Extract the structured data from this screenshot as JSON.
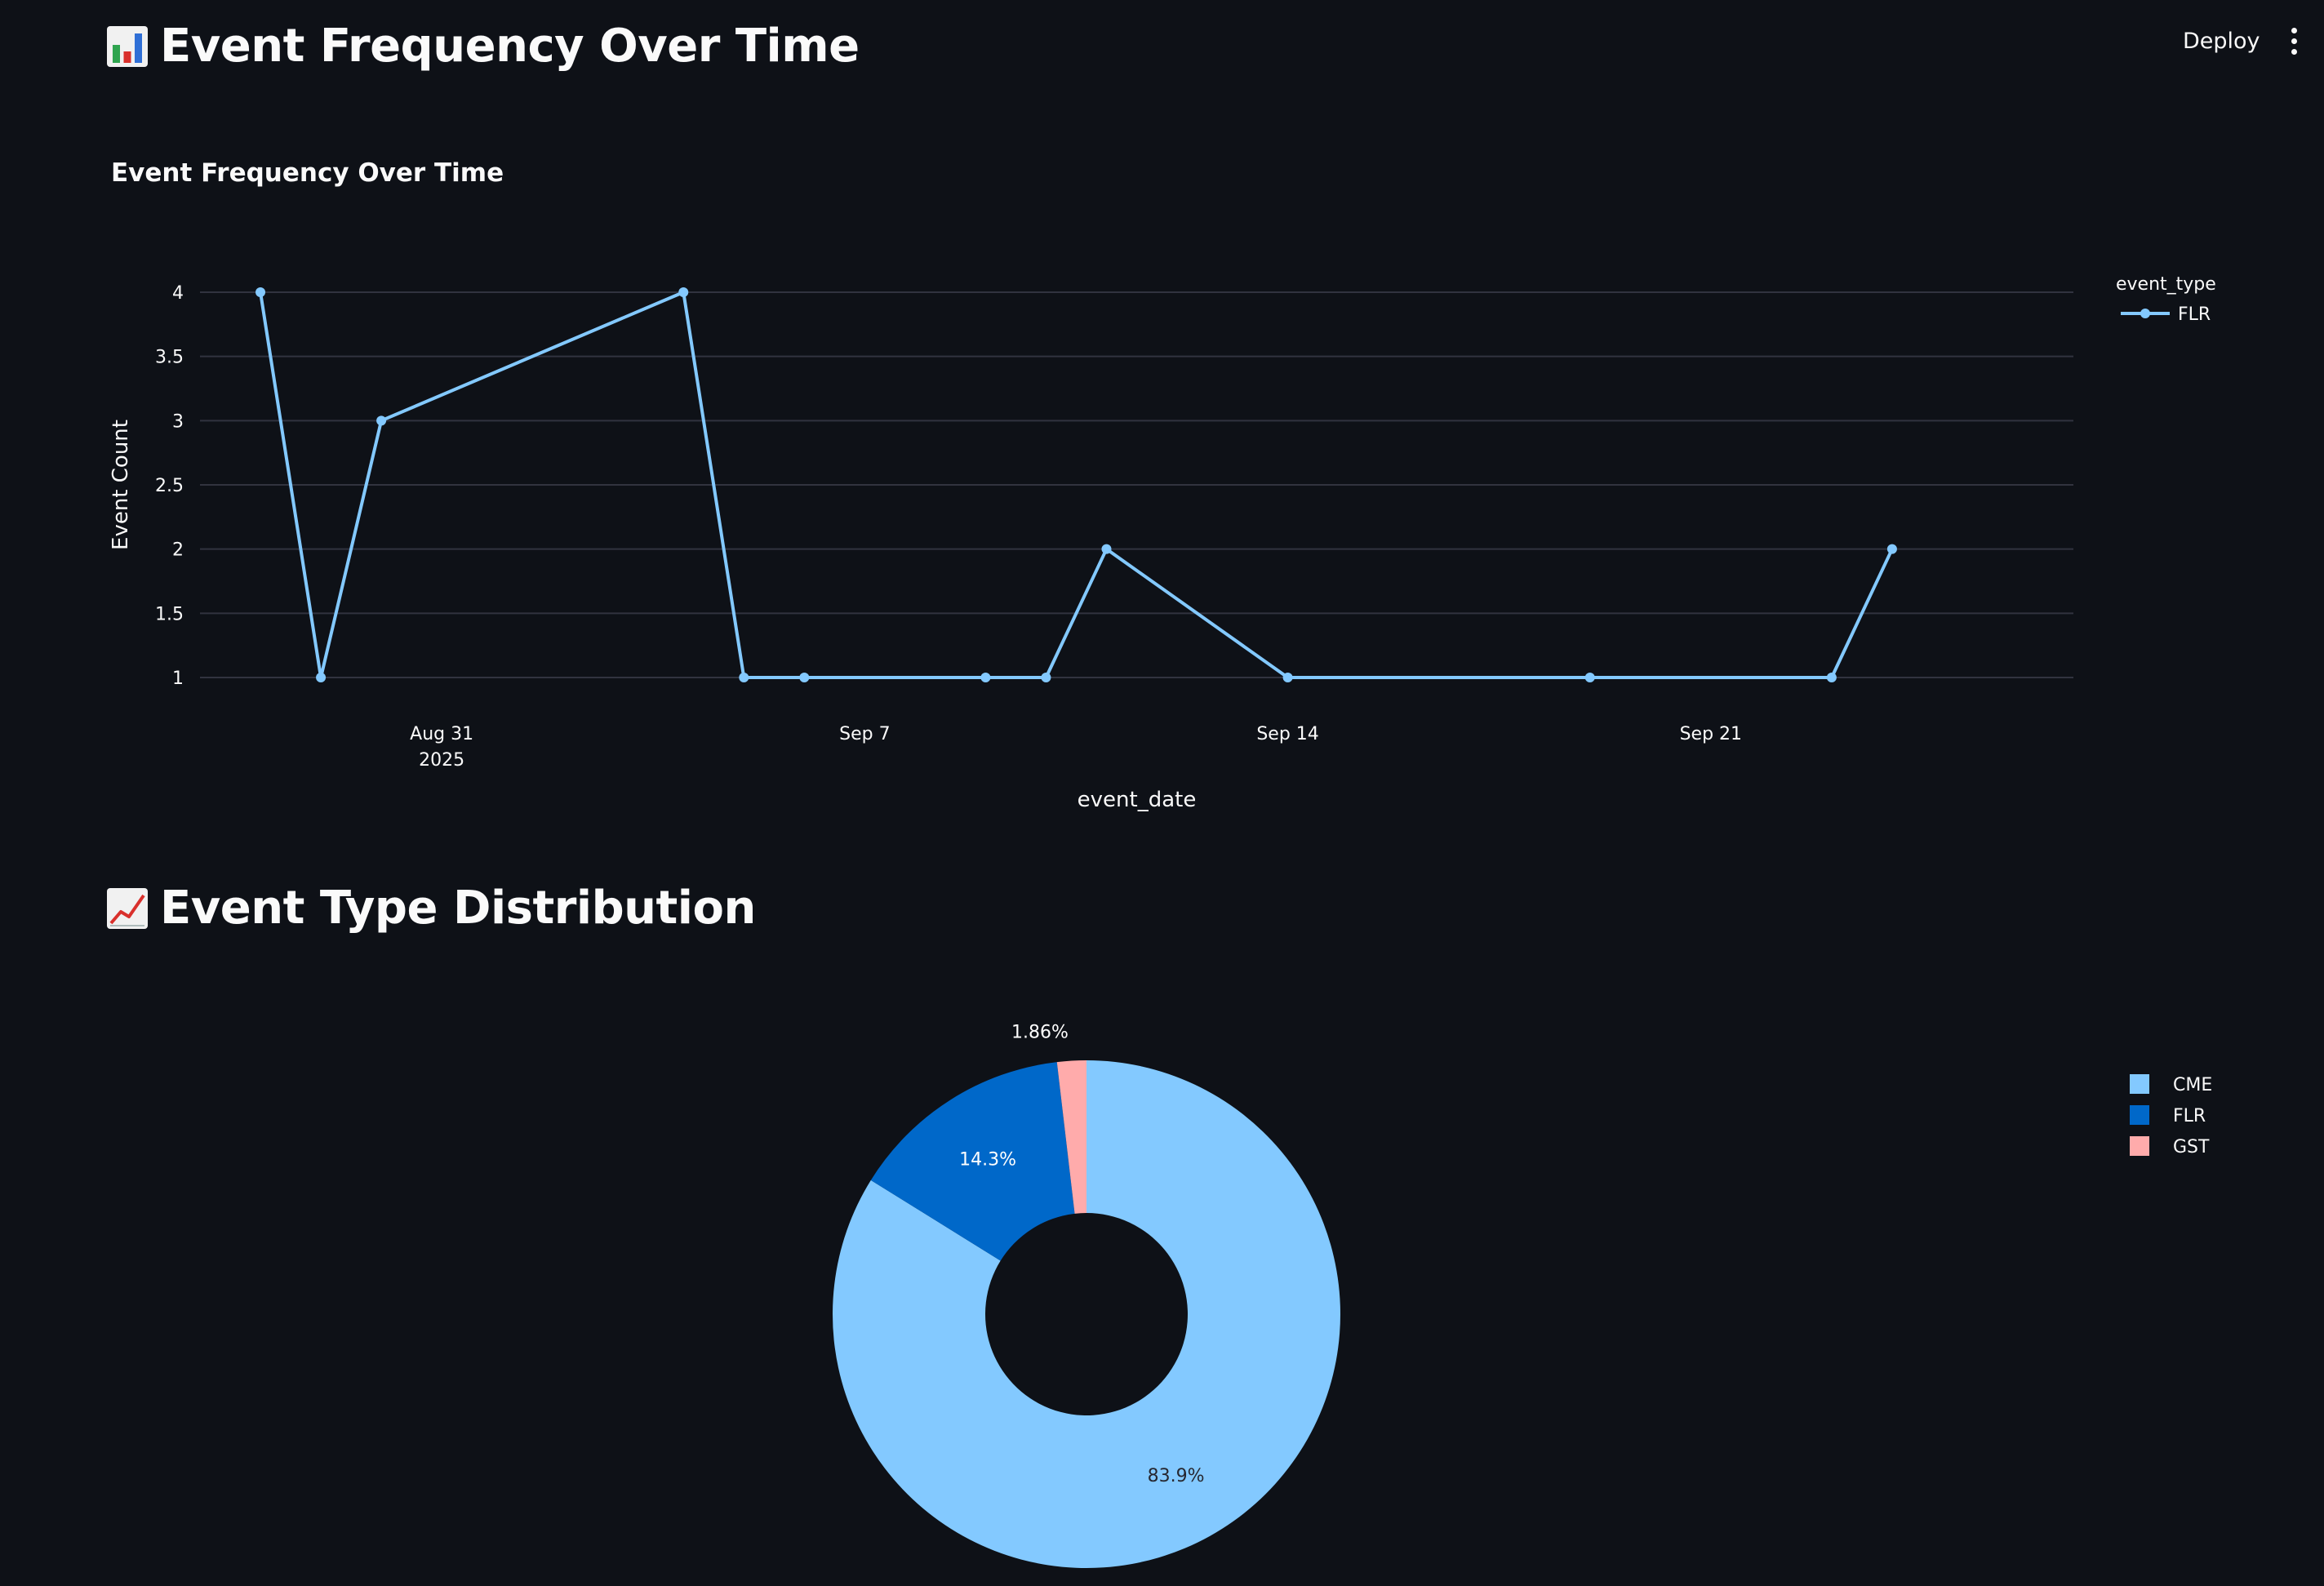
{
  "header": {
    "deploy_label": "Deploy"
  },
  "section1": {
    "title": "Event Frequency Over Time",
    "icon": "bar-chart-emoji-icon"
  },
  "section2": {
    "title": "Event Type Distribution",
    "icon": "chart-increasing-emoji-icon"
  },
  "chart_data": [
    {
      "type": "line",
      "title": "Event Frequency Over Time",
      "xlabel": "event_date",
      "ylabel": "Event Count",
      "legend_title": "event_type",
      "legend_position": "top-right",
      "grid": true,
      "ylim": [
        1,
        4
      ],
      "yticks": [
        {
          "value": 1,
          "label": "1"
        },
        {
          "value": 1.5,
          "label": "1.5"
        },
        {
          "value": 2,
          "label": "2"
        },
        {
          "value": 2.5,
          "label": "2.5"
        },
        {
          "value": 3,
          "label": "3"
        },
        {
          "value": 3.5,
          "label": "3.5"
        },
        {
          "value": 4,
          "label": "4"
        }
      ],
      "xticks": [
        {
          "date": "2025-08-31",
          "label": "Aug 31",
          "label2": "2025"
        },
        {
          "date": "2025-09-07",
          "label": "Sep 7",
          "label2": ""
        },
        {
          "date": "2025-09-14",
          "label": "Sep 14",
          "label2": ""
        },
        {
          "date": "2025-09-21",
          "label": "Sep 21",
          "label2": ""
        }
      ],
      "xlim": [
        "2025-08-27",
        "2025-09-27"
      ],
      "series": [
        {
          "name": "FLR",
          "color": "#83c9ff",
          "x": [
            "2025-08-28",
            "2025-08-29",
            "2025-08-30",
            "2025-09-04",
            "2025-09-05",
            "2025-09-06",
            "2025-09-09",
            "2025-09-10",
            "2025-09-11",
            "2025-09-14",
            "2025-09-19",
            "2025-09-23",
            "2025-09-24"
          ],
          "y": [
            4,
            1,
            3,
            4,
            1,
            1,
            1,
            1,
            2,
            1,
            1,
            1,
            2
          ]
        }
      ]
    },
    {
      "type": "pie",
      "hole": true,
      "legend_position": "top-right",
      "slices": [
        {
          "label": "CME",
          "value": 83.9,
          "text": "83.9%",
          "color": "#83c9ff",
          "text_color": "#262730"
        },
        {
          "label": "FLR",
          "value": 14.3,
          "text": "14.3%",
          "color": "#0068c9",
          "text_color": "#ffffff"
        },
        {
          "label": "GST",
          "value": 1.86,
          "text": "1.86%",
          "color": "#ffabab",
          "text_color": "#ffffff"
        }
      ]
    }
  ]
}
